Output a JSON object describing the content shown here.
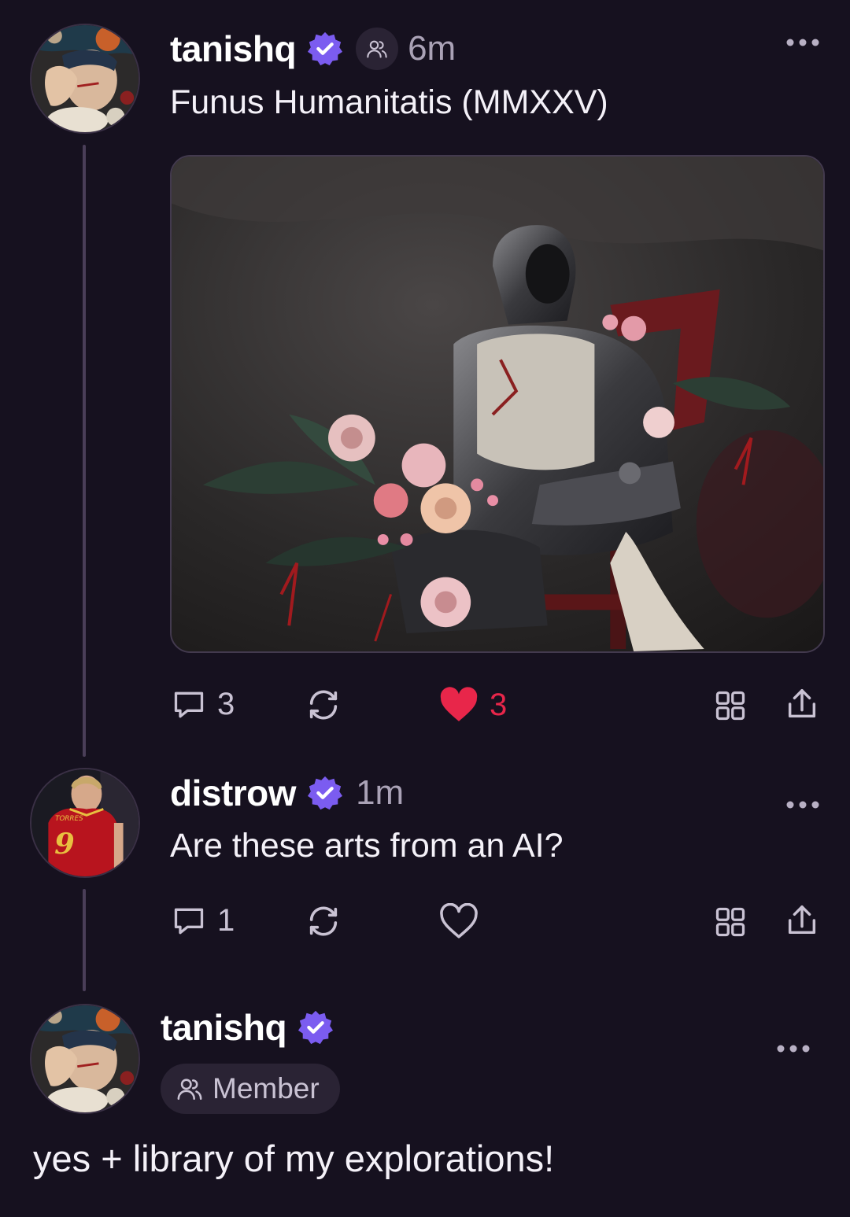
{
  "posts": [
    {
      "username": "tanishq",
      "verified": true,
      "badge_icon": "people-icon",
      "time": "6m",
      "text": "Funus Humanitatis (MMXXV)",
      "has_image": true,
      "actions": {
        "replies": "3",
        "likes": "3",
        "liked": true
      }
    },
    {
      "username": "distrow",
      "verified": true,
      "time": "1m",
      "text": "Are these arts from an AI?",
      "jersey_text": "TORRES",
      "jersey_number": "9",
      "actions": {
        "replies": "1",
        "liked": false
      }
    },
    {
      "username": "tanishq",
      "verified": true,
      "member_label": "Member",
      "text": "yes + library of my explorations!"
    }
  ],
  "colors": {
    "background": "#16111f",
    "verified": "#7b5cf0",
    "liked": "#e8264a",
    "muted": "#aaa2b6"
  }
}
